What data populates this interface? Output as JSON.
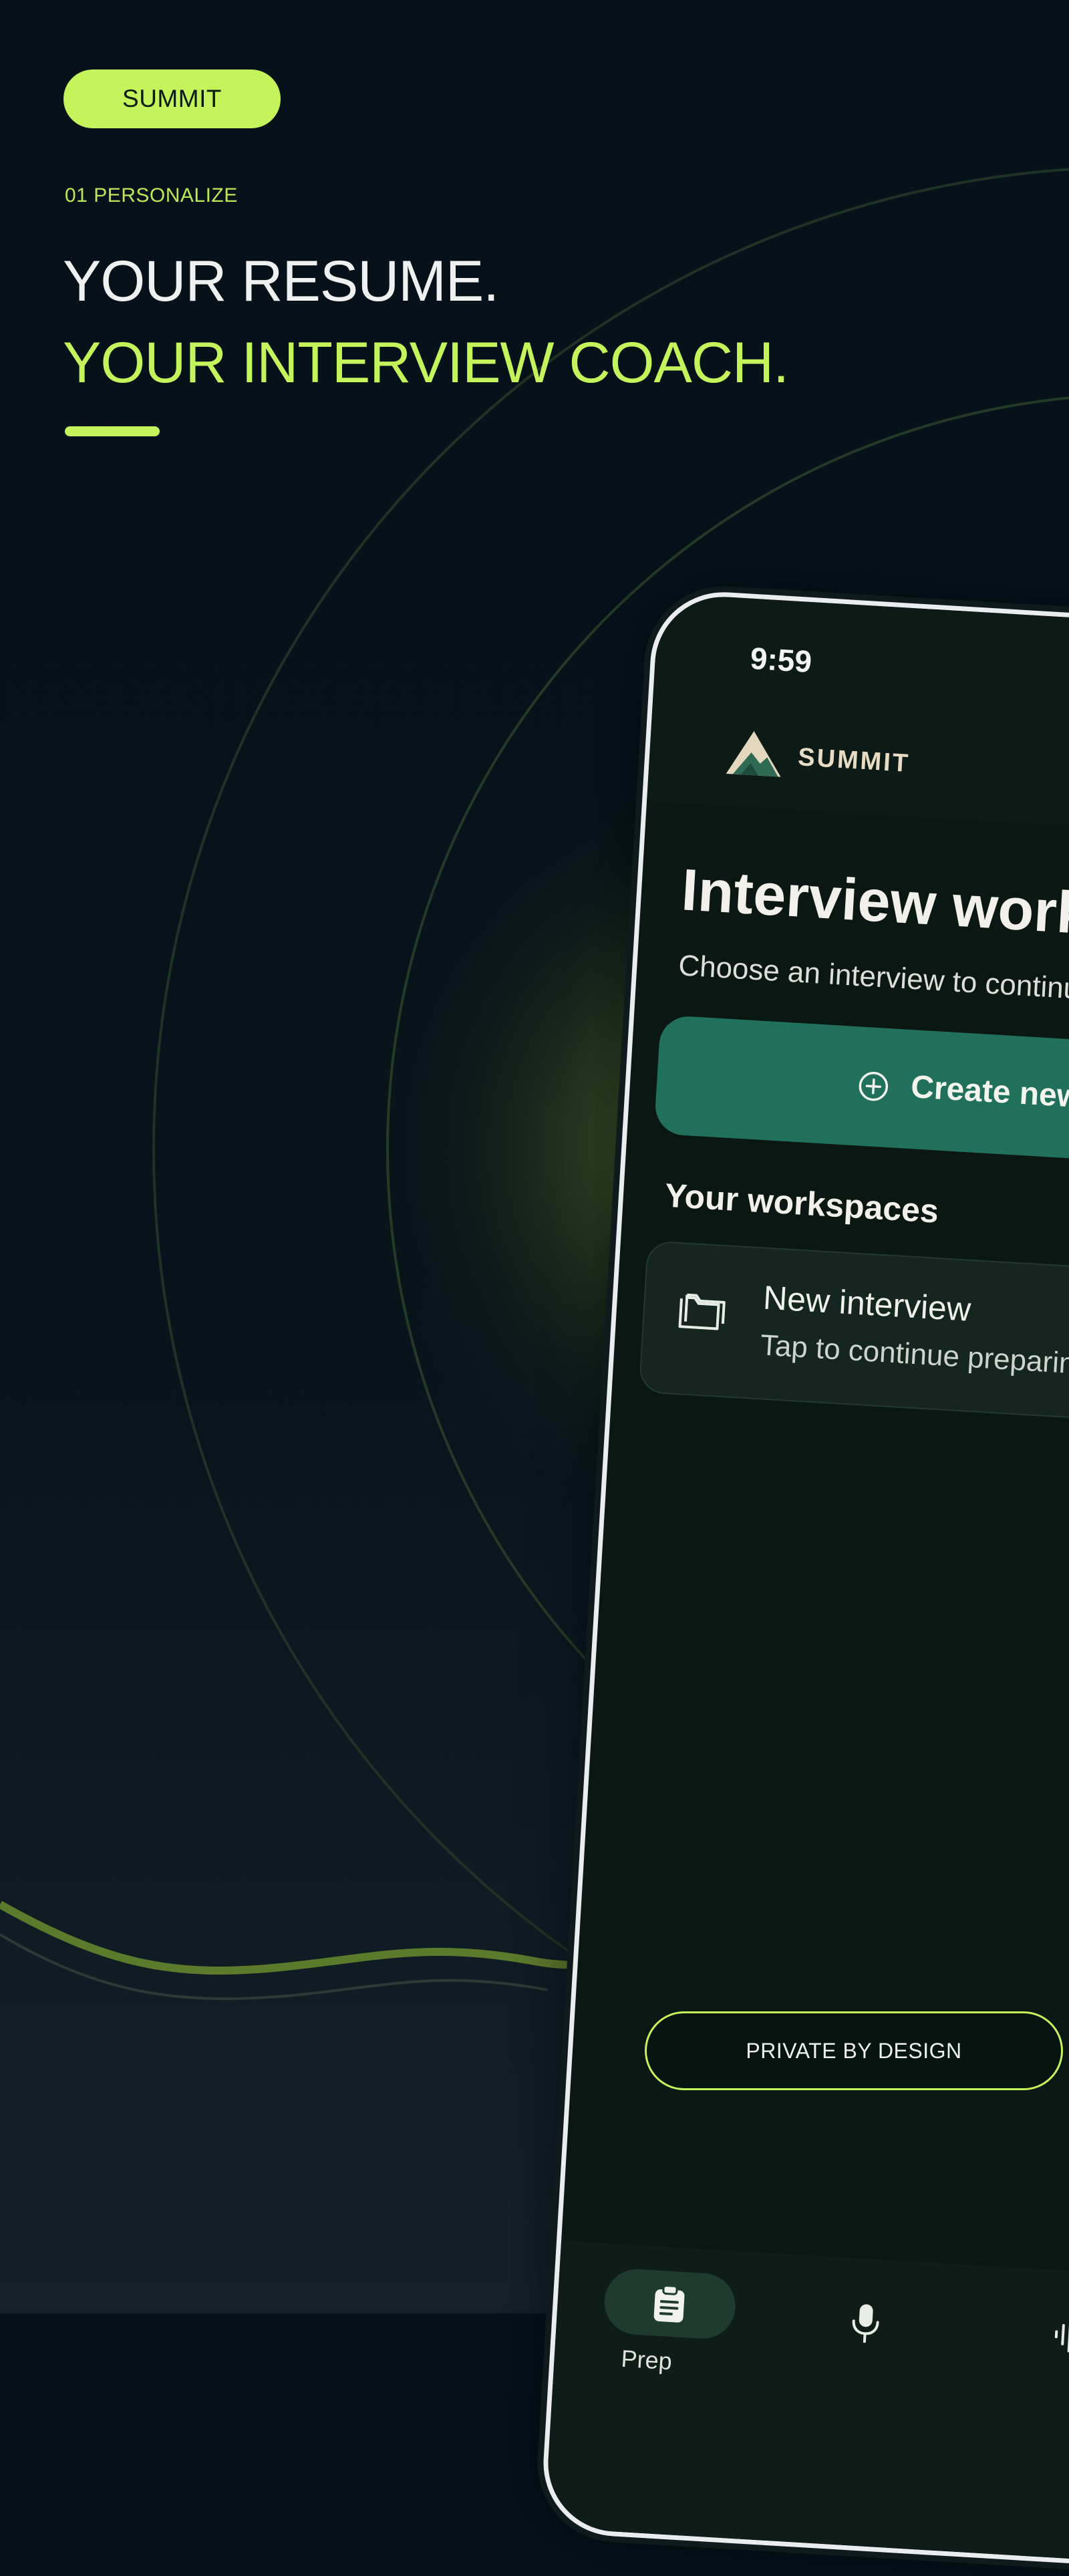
{
  "promo": {
    "brand_pill": "SUMMIT",
    "step_label": "01 PERSONALIZE",
    "headline_line1": "YOUR RESUME.",
    "headline_line2": "YOUR INTERVIEW COACH.",
    "badge": "PRIVATE BY DESIGN"
  },
  "phone": {
    "status_time": "9:59",
    "brand": "SUMMIT",
    "title": "Interview workspaces",
    "subtitle": "Choose an interview to continue",
    "create_button_label": "Create new",
    "section_title": "Your workspaces",
    "workspaces": [
      {
        "title": "New interview",
        "subtitle": "Tap to continue preparing",
        "icon": "folder-icon"
      }
    ],
    "nav": [
      {
        "label": "Prep",
        "icon": "clipboard-icon",
        "active": true
      },
      {
        "label": "",
        "icon": "microphone-icon",
        "active": false
      },
      {
        "label": "",
        "icon": "waveform-icon",
        "active": false
      }
    ]
  },
  "colors": {
    "accent": "#c4f35c",
    "background": "#061119",
    "primary_button": "#20705c",
    "brand_text": "#e8dcc4"
  }
}
